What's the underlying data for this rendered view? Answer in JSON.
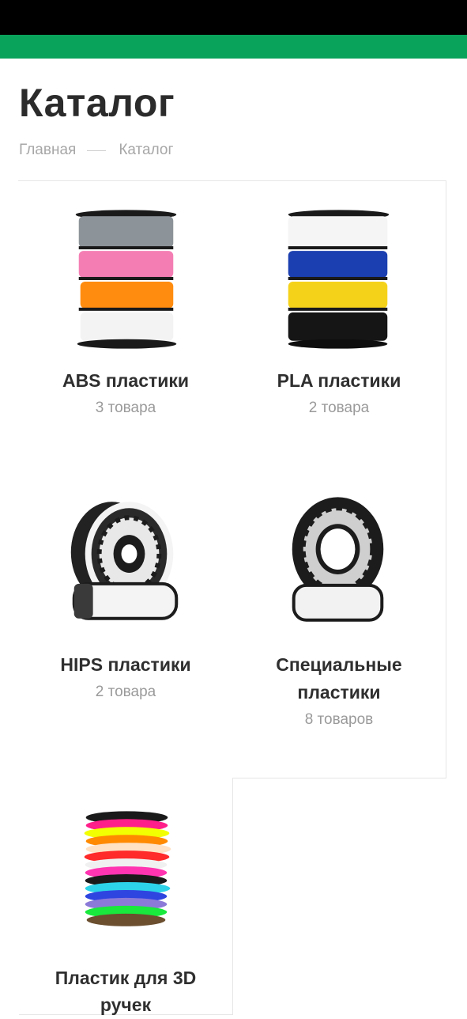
{
  "page": {
    "title": "Каталог",
    "breadcrumb": {
      "home": "Главная",
      "current": "Каталог"
    }
  },
  "categories": [
    {
      "name": "ABS пластики",
      "count": "3 товара",
      "icon": "spool-stack-abs-icon"
    },
    {
      "name": "PLA пластики",
      "count": "2 товара",
      "icon": "spool-stack-pla-icon"
    },
    {
      "name": "HIPS пластики",
      "count": "2 товара",
      "icon": "spool-hips-icon"
    },
    {
      "name_line1": "Специальные",
      "name_line2": "пластики",
      "count": "8 товаров",
      "icon": "spool-special-icon"
    },
    {
      "name_line1": "Пластик для 3D",
      "name_line2": "ручек",
      "icon": "pen-filament-bundle-icon"
    }
  ],
  "colors": {
    "accent": "#0aa35c",
    "status_bar": "#000000",
    "border": "#e6e6e6"
  }
}
